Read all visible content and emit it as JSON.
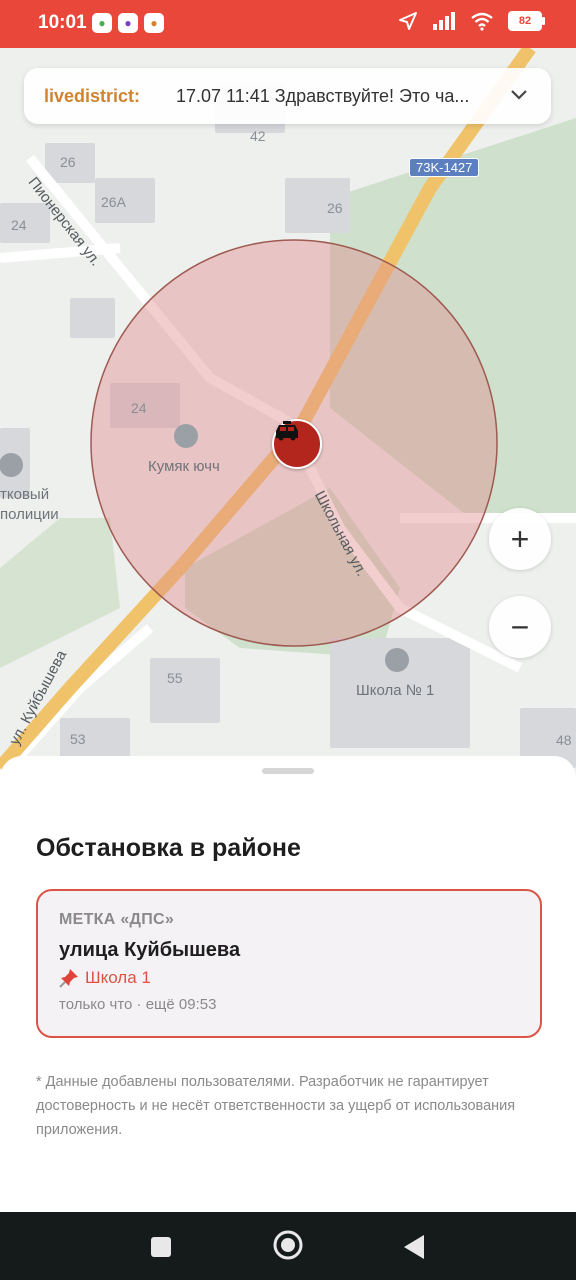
{
  "status_bar": {
    "time": "10:01",
    "battery": "82",
    "icons": [
      "location-arrow-icon",
      "signal-icon",
      "wifi-icon",
      "battery-icon"
    ]
  },
  "notification": {
    "sender": "livedistrict:",
    "text": "17.07 11:41 Здравствуйте! Это ча..."
  },
  "map": {
    "road_badge": "73K-1427",
    "labels": {
      "poi": "Кумяк ючч",
      "school": "Школа № 1",
      "police_line1": "тковый",
      "police_line2": "полиции"
    },
    "streets": {
      "pionerskaya": "Пионерская ул.",
      "shkolnaya": "Школьная ул.",
      "kuybysheva": "ул. Куйбышева"
    },
    "house_numbers": [
      "42",
      "26",
      "26А",
      "24",
      "26",
      "24",
      "55",
      "53",
      "48"
    ],
    "colors": {
      "radius_fill": "#e08b8b",
      "radius_stroke": "#9e5a50",
      "marker": "#b3261e"
    }
  },
  "zoom": {
    "in_label": "+",
    "out_label": "−"
  },
  "sheet": {
    "title": "Обстановка в районе",
    "card": {
      "tag": "МЕТКА «ДПС»",
      "street": "улица Куйбышева",
      "place_icon": "pin-icon",
      "place": "Школа 1",
      "meta": "только что · ещё 09:53"
    },
    "disclaimer": "* Данные добавлены пользователями. Разработчик не гарантирует достоверность и не несёт ответственности за ущерб от использования приложения."
  },
  "colors": {
    "accent": "#e8473a",
    "card_border": "#dc5446"
  }
}
